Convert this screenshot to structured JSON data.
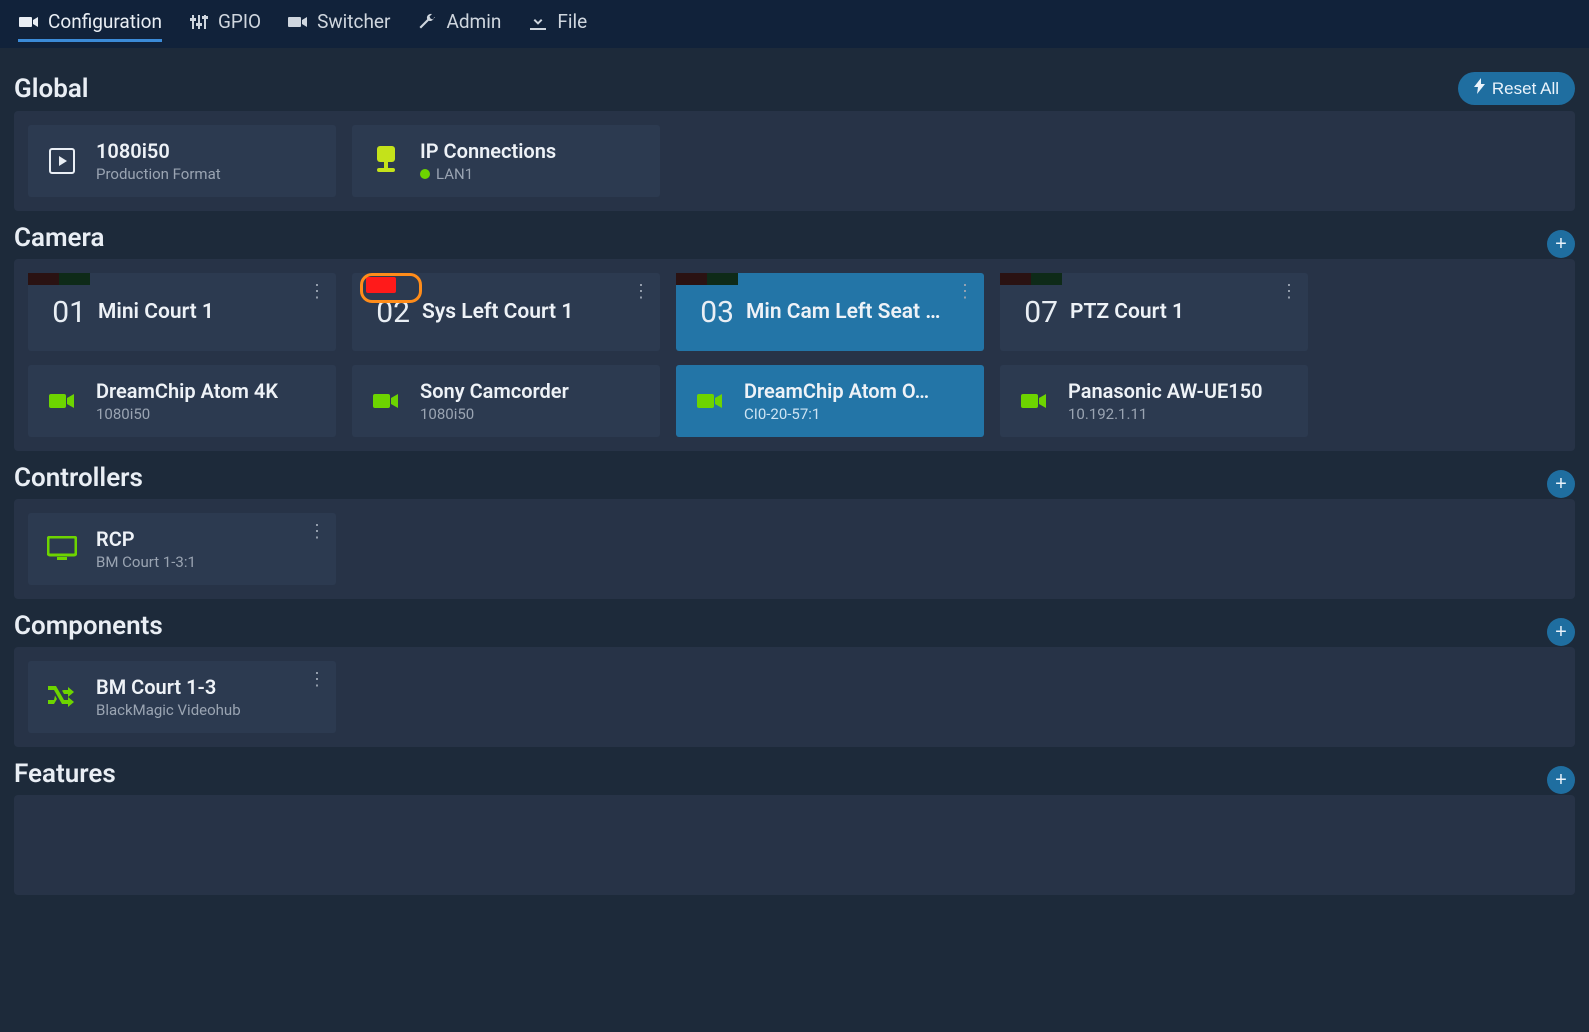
{
  "nav": {
    "configuration": "Configuration",
    "gpio": "GPIO",
    "switcher": "Switcher",
    "admin": "Admin",
    "file": "File"
  },
  "sections": {
    "global": "Global",
    "camera": "Camera",
    "controllers": "Controllers",
    "components": "Components",
    "features": "Features"
  },
  "buttons": {
    "reset_all": "Reset All"
  },
  "global": {
    "format": {
      "title": "1080i50",
      "sub": "Production Format"
    },
    "ip": {
      "title": "IP Connections",
      "sub": "LAN1"
    }
  },
  "cameras": [
    {
      "num": "01",
      "name": "Mini Court 1",
      "device": "DreamChip Atom 4K",
      "sub": "1080i50",
      "selected": false,
      "highlight": false
    },
    {
      "num": "02",
      "name": "Sys Left Court 1",
      "device": "Sony Camcorder",
      "sub": "1080i50",
      "selected": false,
      "highlight": true
    },
    {
      "num": "03",
      "name": "Min Cam Left Seat …",
      "device": "DreamChip Atom O…",
      "sub": "CI0-20-57:1",
      "selected": true,
      "highlight": false
    },
    {
      "num": "07",
      "name": "PTZ Court 1",
      "device": "Panasonic AW-UE150",
      "sub": "10.192.1.11",
      "selected": false,
      "highlight": false
    }
  ],
  "controllers": [
    {
      "title": "RCP",
      "sub": "BM Court 1-3:1"
    }
  ],
  "components": [
    {
      "title": "BM Court 1-3",
      "sub": "BlackMagic Videohub"
    }
  ]
}
